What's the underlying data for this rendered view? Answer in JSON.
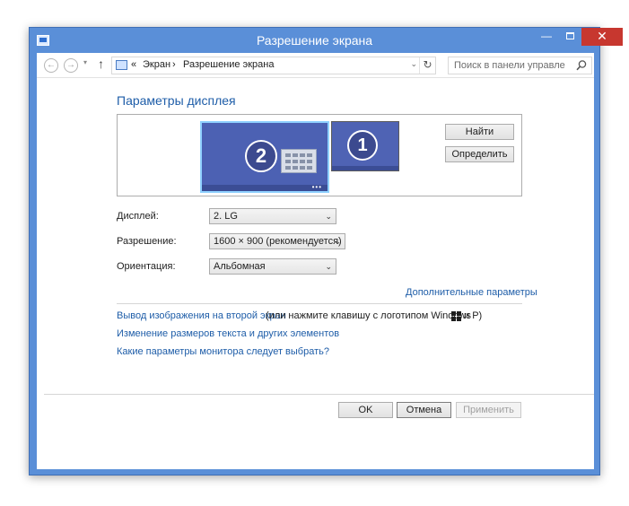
{
  "window": {
    "title": "Разрешение экрана",
    "close_glyph": "✕",
    "minimize_glyph": "—"
  },
  "navbar": {
    "back_glyph": "←",
    "forward_glyph": "→",
    "dropdown_glyph": "▾",
    "up_glyph": "↑",
    "address_prefix": "«",
    "breadcrumb_1": "Экран",
    "breadcrumb_sep": "›",
    "breadcrumb_2": "Разрешение экрана",
    "address_dropdown_glyph": "⌄",
    "refresh_glyph": "↻",
    "search_placeholder": "Поиск в панели управления"
  },
  "main": {
    "heading": "Параметры дисплея",
    "monitors": [
      {
        "number": "2",
        "selected": true
      },
      {
        "number": "1",
        "selected": false
      }
    ],
    "monitor_more_glyph": "•••",
    "find_button": "Найти",
    "identify_button": "Определить",
    "display_label": "Дисплей:",
    "display_value": "2. LG",
    "resolution_label": "Разрешение:",
    "resolution_value": "1600 × 900 (рекомендуется)",
    "orientation_label": "Ориентация:",
    "orientation_value": "Альбомная",
    "select_arrow": "⌄",
    "advanced_link": "Дополнительные параметры",
    "project_link": "Вывод изображения на второй экран",
    "project_hint_before": "(или нажмите клавишу с логотипом Windows",
    "project_hint_after": "и P)",
    "text_size_link": "Изменение размеров текста и других элементов",
    "which_settings_link": "Какие параметры монитора следует выбрать?"
  },
  "footer": {
    "ok": "OK",
    "cancel": "Отмена",
    "apply": "Применить"
  },
  "colors": {
    "accent": "#1e5da8",
    "titlebar": "#5a8fd8",
    "close": "#c7372f",
    "monitor": "#4f63b4"
  }
}
